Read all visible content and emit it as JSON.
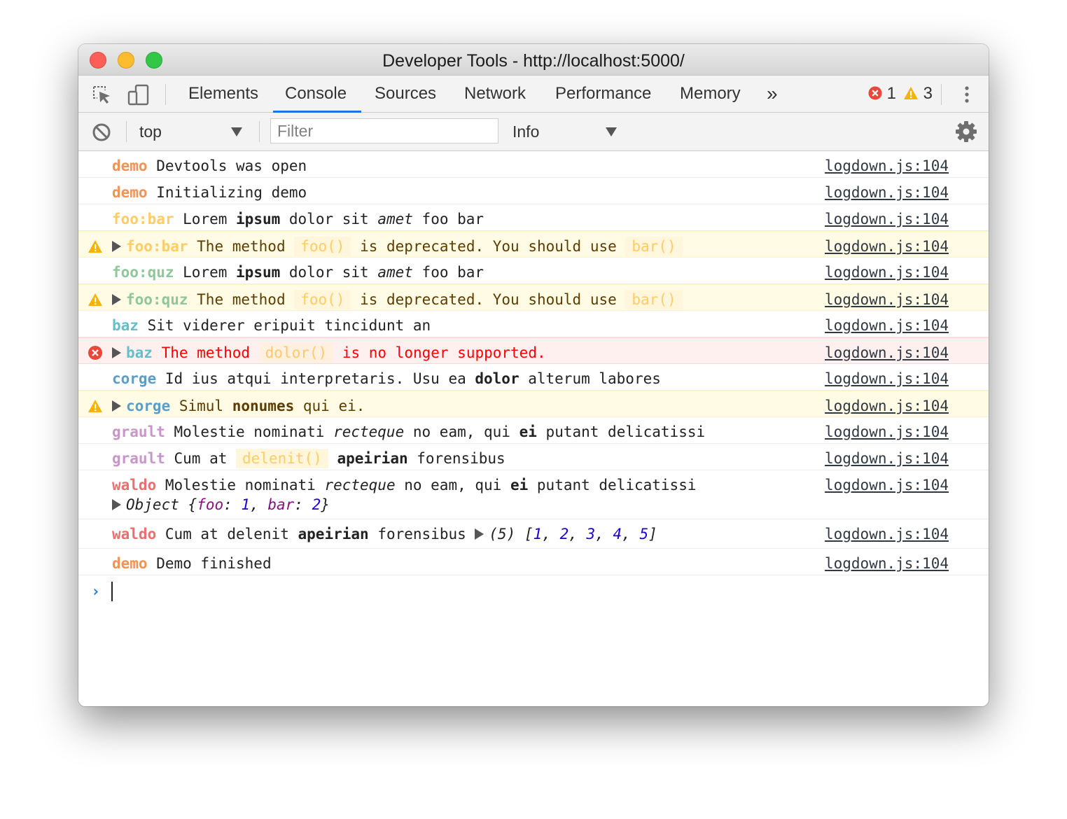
{
  "window": {
    "title": "Developer Tools - http://localhost:5000/"
  },
  "tabs": [
    "Elements",
    "Console",
    "Sources",
    "Network",
    "Performance",
    "Memory"
  ],
  "active_tab": "Console",
  "more_tabs": "»",
  "counts": {
    "errors": "1",
    "warnings": "3"
  },
  "toolbar": {
    "context": "top",
    "filter_placeholder": "Filter",
    "level": "Info"
  },
  "source_label": "logdown.js:104",
  "namespace_colors": {
    "demo": "#ef9456",
    "foo:bar": "#ffcc66",
    "foo:quz": "#8fc79a",
    "baz": "#62c0c8",
    "corge": "#5b9ec8",
    "grault": "#c896c8",
    "waldo": "#ec6f6f"
  },
  "rows": [
    {
      "level": "log",
      "ns": "demo",
      "parts": [
        " Devtools was open"
      ]
    },
    {
      "level": "log",
      "ns": "demo",
      "parts": [
        " Initializing demo"
      ]
    },
    {
      "level": "log",
      "ns": "foo:bar",
      "parts": [
        " Lorem ",
        "ipsum",
        " dolor sit ",
        "amet",
        " foo bar"
      ]
    },
    {
      "level": "warn",
      "ns": "foo:bar",
      "parts": [
        " The method ",
        "foo()",
        " is deprecated. You should use ",
        "bar()"
      ]
    },
    {
      "level": "log",
      "ns": "foo:quz",
      "parts": [
        " Lorem ",
        "ipsum",
        " dolor sit ",
        "amet",
        " foo bar"
      ]
    },
    {
      "level": "warn",
      "ns": "foo:quz",
      "parts": [
        " The method ",
        "foo()",
        " is deprecated. You should use ",
        "bar()"
      ]
    },
    {
      "level": "log",
      "ns": "baz",
      "parts": [
        " Sit viderer eripuit tincidunt an"
      ]
    },
    {
      "level": "error",
      "ns": "baz",
      "parts": [
        " The method ",
        "dolor()",
        " is no longer supported."
      ]
    },
    {
      "level": "log",
      "ns": "corge",
      "parts": [
        " Id ius atqui interpretaris. Usu ea ",
        "dolor",
        " alterum labores"
      ]
    },
    {
      "level": "warn",
      "ns": "corge",
      "parts": [
        " Simul ",
        "nonumes",
        " qui ei."
      ]
    },
    {
      "level": "log",
      "ns": "grault",
      "parts": [
        " Molestie nominati ",
        "recteque",
        " no eam, qui ",
        "ei",
        " putant delicatissi"
      ]
    },
    {
      "level": "log",
      "ns": "grault",
      "parts": [
        " Cum at ",
        "delenit()",
        " ",
        "apeirian",
        " forensibus"
      ]
    },
    {
      "level": "log",
      "ns": "waldo",
      "parts": [
        " Molestie nominati ",
        "recteque",
        " no eam, qui ",
        "ei",
        " putant delicatissi"
      ],
      "object": {
        "label": "Object",
        "open": "{",
        "k1": "foo",
        "v1": "1",
        "k2": "bar",
        "v2": "2",
        "close": "}"
      }
    },
    {
      "level": "log",
      "ns": "waldo",
      "parts": [
        " Cum at delenit ",
        "apeirian",
        " forensibus "
      ],
      "array": {
        "length": "(5)",
        "values": [
          "1",
          "2",
          "3",
          "4",
          "5"
        ]
      }
    },
    {
      "level": "log",
      "ns": "demo",
      "parts": [
        " Demo finished"
      ]
    }
  ],
  "prompt": "›"
}
